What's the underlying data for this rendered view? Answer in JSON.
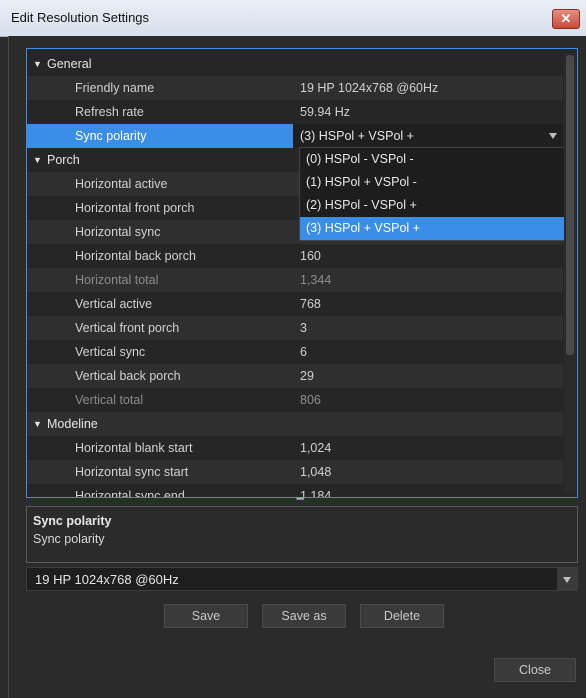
{
  "window": {
    "title": "Edit Resolution Settings",
    "close_icon": "close-icon"
  },
  "categories": {
    "general": "General",
    "porch": "Porch",
    "modeline": "Modeline"
  },
  "rows": [
    {
      "label": "Friendly name",
      "value": "19 HP 1024x768 @60Hz"
    },
    {
      "label": "Refresh rate",
      "value": "59.94 Hz"
    },
    {
      "label": "Sync polarity",
      "value": "(3) HSPol + VSPol +"
    },
    {
      "label": "Horizontal active",
      "value": ""
    },
    {
      "label": "Horizontal front porch",
      "value": ""
    },
    {
      "label": "Horizontal sync",
      "value": ""
    },
    {
      "label": "Horizontal back porch",
      "value": "160"
    },
    {
      "label": "Horizontal total",
      "value": "1,344"
    },
    {
      "label": "Vertical active",
      "value": "768"
    },
    {
      "label": "Vertical front porch",
      "value": "3"
    },
    {
      "label": "Vertical sync",
      "value": "6"
    },
    {
      "label": "Vertical back porch",
      "value": "29"
    },
    {
      "label": "Vertical total",
      "value": "806"
    },
    {
      "label": "Horizontal blank start",
      "value": "1,024"
    },
    {
      "label": "Horizontal sync start",
      "value": "1,048"
    },
    {
      "label": "Horizontal sync end",
      "value": "1,184"
    }
  ],
  "dropdown_options": [
    "(0) HSPol - VSPol -",
    "(1) HSPol + VSPol -",
    "(2) HSPol - VSPol +",
    "(3) HSPol + VSPol +"
  ],
  "description": {
    "title": "Sync polarity",
    "text": "Sync polarity"
  },
  "preset_combo": {
    "value": "19 HP 1024x768 @60Hz"
  },
  "buttons": {
    "save": "Save",
    "save_as": "Save as",
    "delete": "Delete",
    "close": "Close"
  }
}
